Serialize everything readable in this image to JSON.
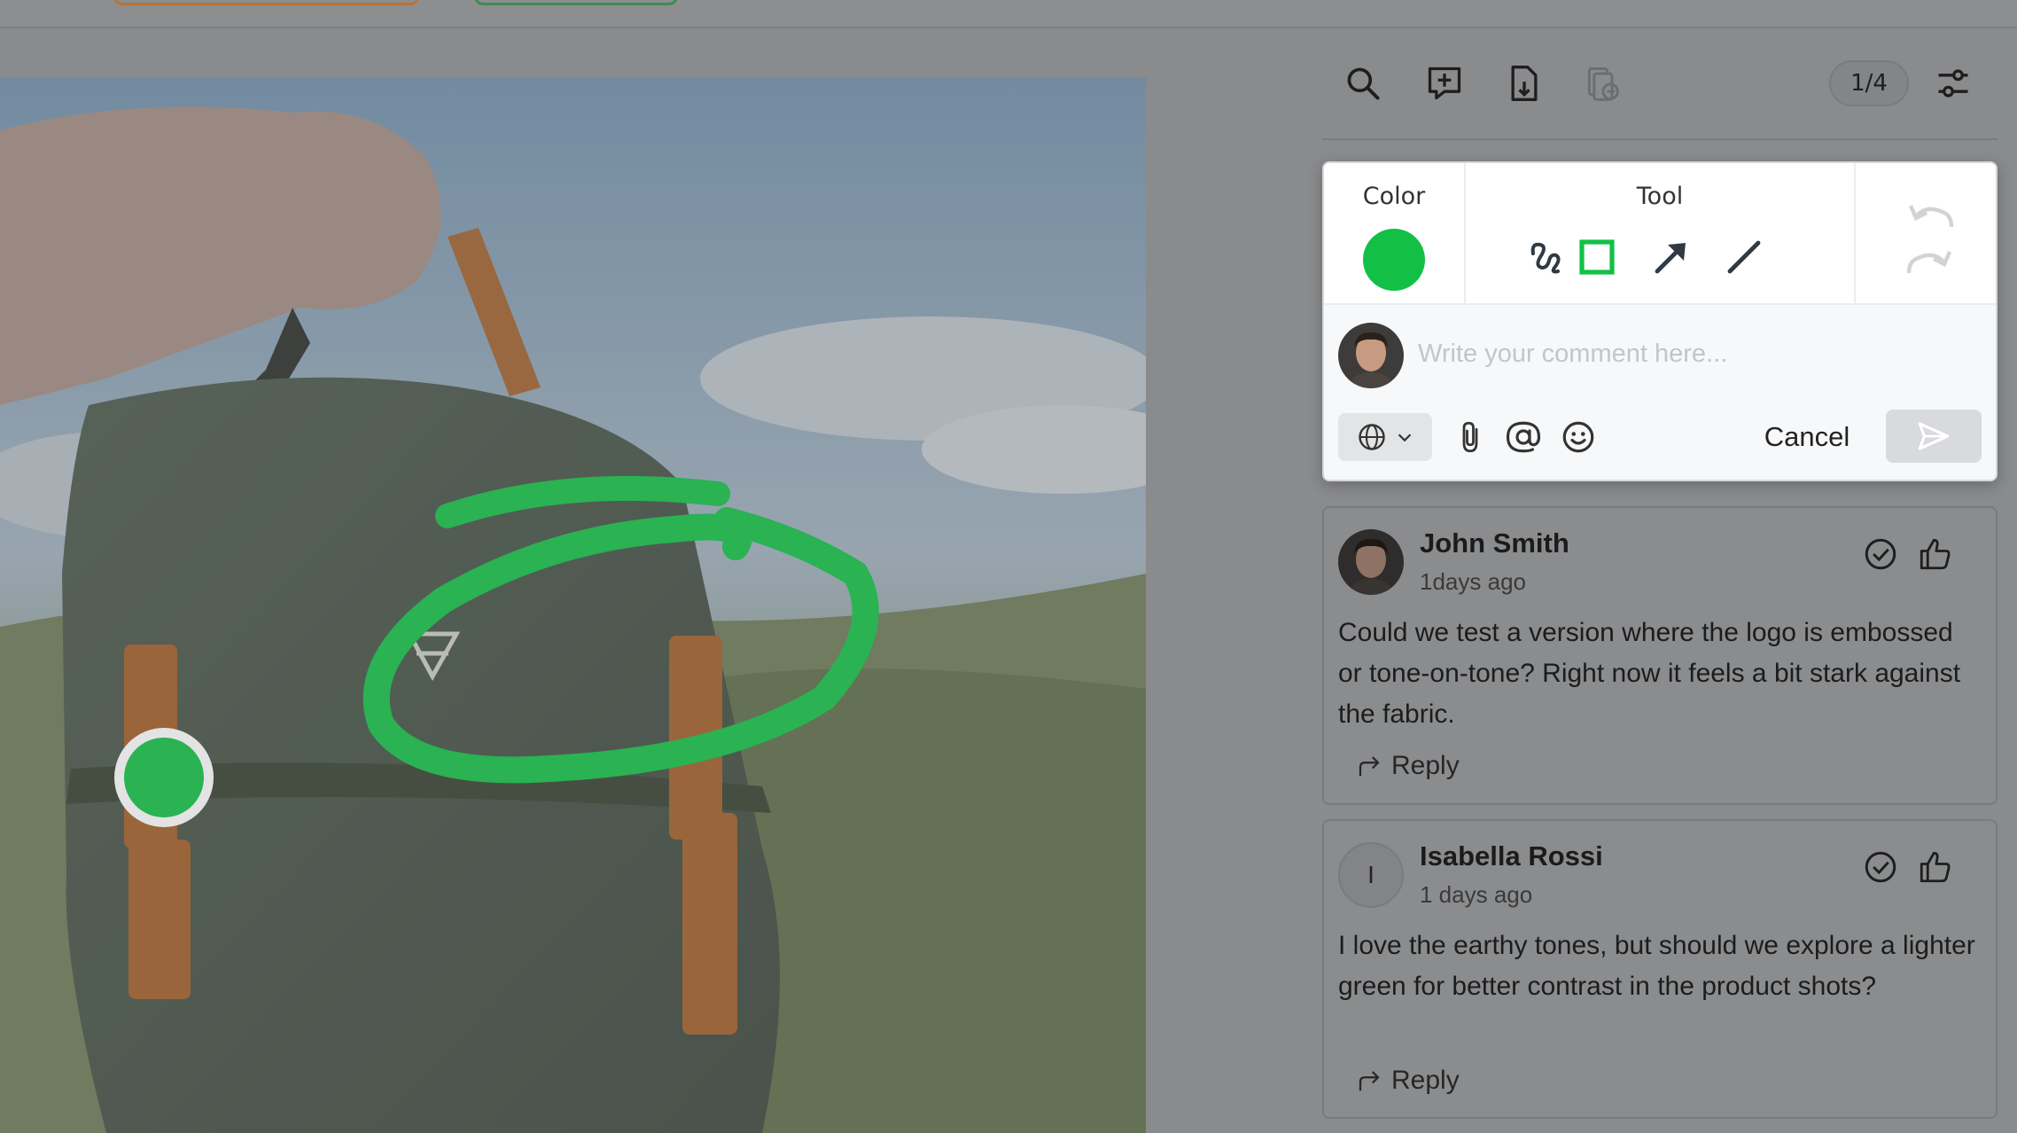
{
  "colors": {
    "accent": "#12c046",
    "dim_background": "#8a8b8d",
    "panel": "#ffffff"
  },
  "toolbar": {
    "icons": [
      "search-icon",
      "add-comment-icon",
      "download-file-icon",
      "compare-versions-icon",
      "filter-settings-icon"
    ],
    "page_counter": "1/4"
  },
  "composer": {
    "color_label": "Color",
    "tool_label": "Tool",
    "selected_color": "#12c046",
    "tools": [
      "freehand-icon",
      "rectangle-icon",
      "arrow-icon",
      "line-icon"
    ],
    "selected_tool": "rectangle",
    "placeholder": "Write your comment here...",
    "cancel_label": "Cancel"
  },
  "comments": [
    {
      "author": "John Smith",
      "time": "1days ago",
      "body": "Could we test a version where the logo is embossed or tone-on-tone? Right now it feels a bit stark against the fabric.",
      "reply_label": "Reply"
    },
    {
      "author": "Isabella Rossi",
      "initial": "I",
      "time": "1 days ago",
      "body": "I love the earthy tones, but should we explore a lighter green for better contrast in the product shots?",
      "reply_label": "Reply"
    }
  ]
}
